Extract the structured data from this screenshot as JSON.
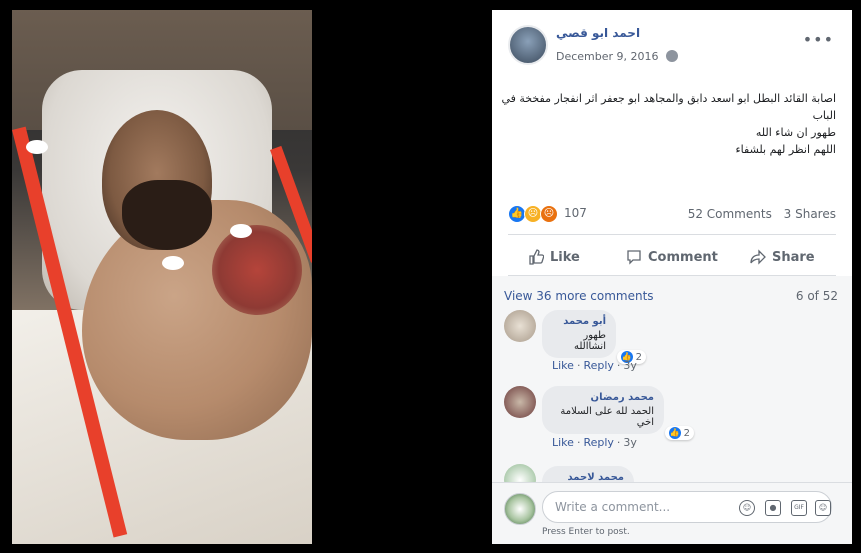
{
  "post": {
    "author": "احمد ابو قصي",
    "date": "December 9, 2016",
    "globe_icon": "globe-icon",
    "more_icon": "more-options-icon",
    "text_lines": [
      "اصابة القائد البطل ابو اسعد دابق والمجاهد ابو جعفر اثر انفجار مفخخة في",
      "الباب",
      "طهور ان شاء الله",
      "اللهم انظر لهم بلشفاء"
    ],
    "reaction_count": "107",
    "reactions": [
      "like",
      "sad",
      "angry"
    ],
    "comments_count": "52 Comments",
    "shares_count": "3 Shares"
  },
  "actions": {
    "like": "Like",
    "comment": "Comment",
    "share": "Share"
  },
  "comments_section": {
    "view_more": "View 36 more comments",
    "position": "6 of 52",
    "items": [
      {
        "name": "أبو محمد",
        "text": "طهور انشاالله",
        "likes": "2",
        "like": "Like",
        "reply": "Reply",
        "time": "3y"
      },
      {
        "name": "محمد رمضان",
        "text": "الحمد لله على السلامة اخي",
        "likes": "2",
        "like": "Like",
        "reply": "Reply",
        "time": "3y"
      },
      {
        "name": "محمد لاحمد"
      }
    ]
  },
  "composer": {
    "placeholder": "Write a comment...",
    "hint": "Press Enter to post.",
    "tools": [
      "emoji-icon",
      "camera-icon",
      "gif-icon",
      "sticker-icon"
    ]
  },
  "colors": {
    "link": "#385898",
    "muted": "#606770",
    "like_blue": "#1877f2"
  }
}
